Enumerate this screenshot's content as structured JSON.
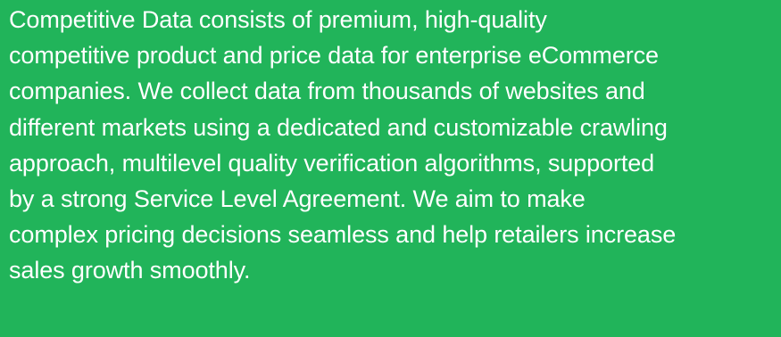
{
  "panel": {
    "background_color": "#21b45a",
    "text_color": "#ffffff",
    "lines": [
      "Competitive Data consists of premium, high-quality",
      "competitive product and price data for enterprise eCommerce",
      "companies. We collect data from thousands of websites and",
      "different markets using a dedicated and customizable crawling",
      "approach, multilevel quality verification algorithms, supported",
      "by a strong Service Level Agreement. We aim to make",
      "complex pricing decisions seamless and help retailers increase",
      "sales growth smoothly."
    ]
  }
}
